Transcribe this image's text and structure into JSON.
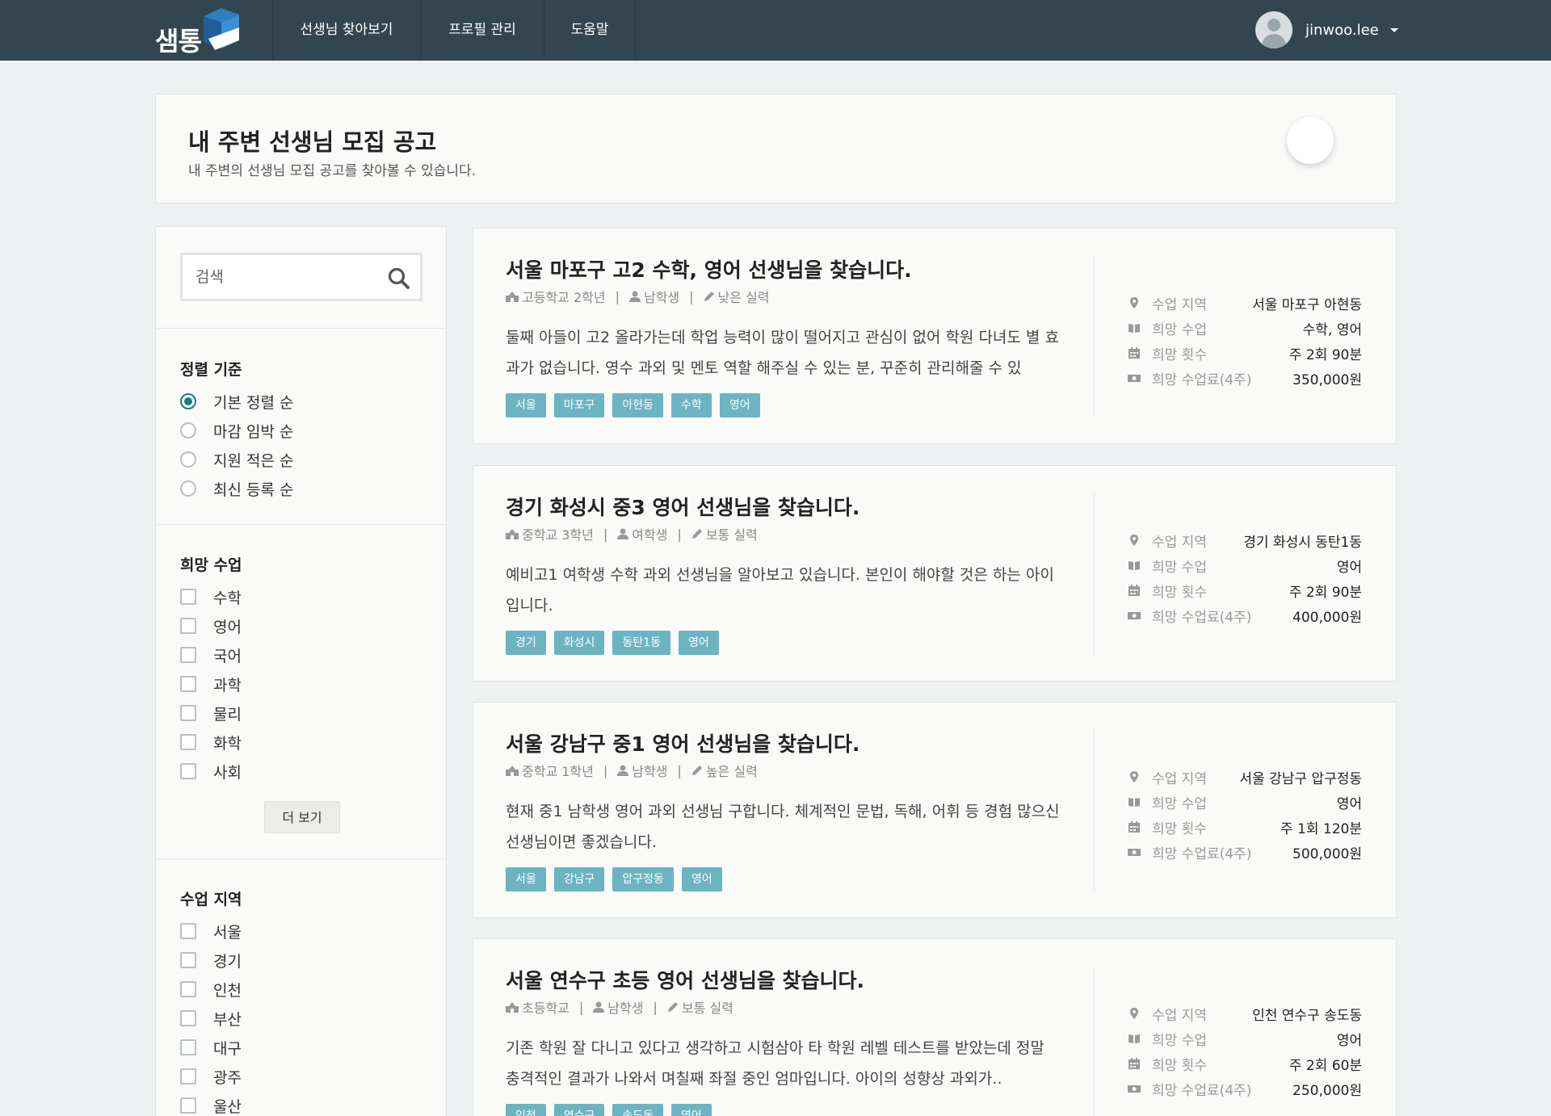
{
  "nav": {
    "logo_text": "샘통",
    "items": [
      "선생님 찾아보기",
      "프로필 관리",
      "도움말"
    ],
    "username": "jinwoo.lee"
  },
  "header": {
    "title": "내 주변 선생님 모집 공고",
    "subtitle": "내 주변의 선생님 모집 공고를 찾아볼 수 있습니다."
  },
  "sidebar": {
    "search_placeholder": "검색",
    "sort": {
      "title": "정렬 기준",
      "options": [
        "기본 정렬 순",
        "마감 임박 순",
        "지원 적은 순",
        "최신 등록 순"
      ],
      "selected_index": 0
    },
    "subjects": {
      "title": "희망 수업",
      "options": [
        "수학",
        "영어",
        "국어",
        "과학",
        "물리",
        "화학",
        "사회"
      ],
      "more_label": "더 보기"
    },
    "regions": {
      "title": "수업 지역",
      "options": [
        "서울",
        "경기",
        "인천",
        "부산",
        "대구",
        "광주",
        "울산"
      ]
    }
  },
  "info_labels": {
    "region": "수업 지역",
    "subject": "희망 수업",
    "frequency": "희망 횟수",
    "fee": "희망 수업료(4주)"
  },
  "posts": [
    {
      "title": "서울 마포구 고2 수학, 영어 선생님을 찾습니다.",
      "grade": "고등학교 2학년",
      "gender": "남학생",
      "level": "낮은 실력",
      "desc": "둘째 아들이 고2 올라가는데 학업 능력이 많이 떨어지고 관심이 없어 학원 다녀도 별 효과가 없습니다. 영수 과외 및 멘토 역할 해주실 수 있는 분, 꾸준히 관리해줄 수 있",
      "tags": [
        "서울",
        "마포구",
        "아현동",
        "수학",
        "영어"
      ],
      "region": "서울 마포구 아현동",
      "subject": "수학, 영어",
      "frequency": "주 2회 90분",
      "fee": "350,000원"
    },
    {
      "title": "경기 화성시 중3 영어 선생님을 찾습니다.",
      "grade": "중학교 3학년",
      "gender": "여학생",
      "level": "보통 실력",
      "desc": "예비고1 여학생 수학 과외 선생님을 알아보고 있습니다. 본인이 해야할 것은 하는 아이입니다.",
      "tags": [
        "경기",
        "화성시",
        "동탄1동",
        "영어"
      ],
      "region": "경기 화성시 동탄1동",
      "subject": "영어",
      "frequency": "주 2회 90분",
      "fee": "400,000원"
    },
    {
      "title": "서울 강남구 중1 영어 선생님을 찾습니다.",
      "grade": "중학교 1학년",
      "gender": "남학생",
      "level": "높은 실력",
      "desc": "현재 중1 남학생 영어 과외 선생님 구합니다. 체계적인 문법, 독해, 어휘 등 경험 많으신 선생님이면 좋겠습니다.",
      "tags": [
        "서울",
        "강남구",
        "압구정동",
        "영어"
      ],
      "region": "서울 강남구 압구정동",
      "subject": "영어",
      "frequency": "주 1회 120분",
      "fee": "500,000원"
    },
    {
      "title": "서울 연수구 초등 영어 선생님을 찾습니다.",
      "grade": "초등학교",
      "gender": "남학생",
      "level": "보통 실력",
      "desc": "기존 학원 잘 다니고 있다고 생각하고 시험삼아 타 학원 레벨 테스트를 받았는데 정말 충격적인 결과가 나와서 며칠째 좌절 중인 엄마입니다. 아이의 성향상 과외가..",
      "tags": [
        "인천",
        "연수구",
        "송도동",
        "영어"
      ],
      "region": "인천 연수구 송도동",
      "subject": "영어",
      "frequency": "주 2회 60분",
      "fee": "250,000원"
    }
  ]
}
